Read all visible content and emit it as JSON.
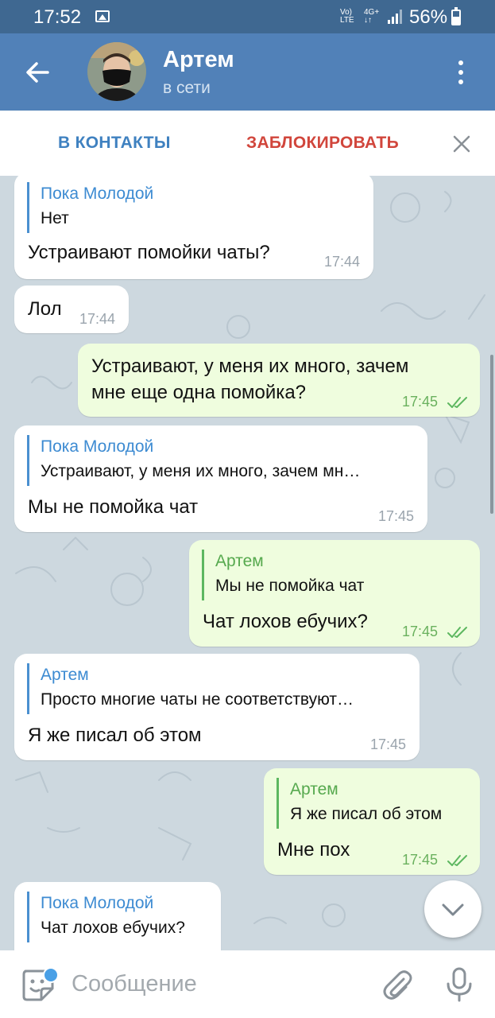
{
  "status_bar": {
    "time": "17:52",
    "network_top": "Vo)",
    "network_bottom": "LTE",
    "mobile_top": "4G+",
    "mobile_bottom": "↓↑",
    "battery": "56%"
  },
  "header": {
    "name": "Артем",
    "status": "в сети"
  },
  "action_bar": {
    "add_contact": "В КОНТАКТЫ",
    "block": "ЗАБЛОКИРОВАТЬ"
  },
  "messages": [
    {
      "dir": "in",
      "reply_author": "Пока Молодой",
      "reply_text": "Нет",
      "text": "Устраивают помойки чаты?",
      "time": "17:44"
    },
    {
      "dir": "in",
      "text": "Лол",
      "time": "17:44"
    },
    {
      "dir": "out",
      "text_line1": "Устраивают, у меня их много, зачем",
      "text_line2": "мне еще одна помойка?",
      "time": "17:45",
      "read": true
    },
    {
      "dir": "in",
      "reply_author": "Пока Молодой",
      "reply_text": "Устраивают, у меня их много, зачем мн…",
      "text": "Мы не помойка чат",
      "time": "17:45"
    },
    {
      "dir": "out",
      "reply_author": "Артем",
      "reply_text": "Мы не помойка чат",
      "text": "Чат лохов ебучих?",
      "time": "17:45",
      "read": true
    },
    {
      "dir": "in",
      "reply_author": "Артем",
      "reply_text": "Просто многие чаты не соответствуют…",
      "text": "Я же писал об этом",
      "time": "17:45"
    },
    {
      "dir": "out",
      "reply_author": "Артем",
      "reply_text": "Я же писал об этом",
      "text": "Мне пох",
      "time": "17:45",
      "read": true
    },
    {
      "dir": "in",
      "reply_author": "Пока Молодой",
      "reply_text": "Чат лохов ебучих?",
      "text": "",
      "time": ""
    }
  ],
  "input": {
    "placeholder": "Сообщение"
  },
  "colors": {
    "header": "#5181b8",
    "status_bar": "#3f6891",
    "incoming_bubble": "#ffffff",
    "outgoing_bubble": "#effdde",
    "accent_blue": "#3f81c0",
    "block_red": "#d1463c"
  }
}
